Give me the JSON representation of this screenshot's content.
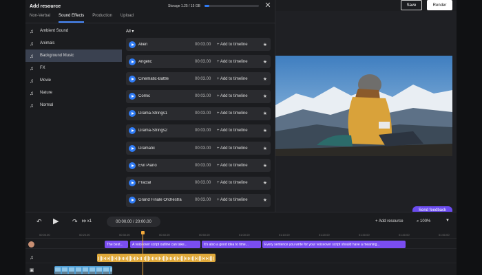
{
  "modal": {
    "title": "Add resource",
    "storage_label": "Storage 1.25 / 15 GB",
    "storage_fraction": 0.083,
    "tabs": [
      "Non-Verbal",
      "Sound Effects",
      "Production",
      "Upload"
    ],
    "active_tab": "Sound Effects",
    "categories": [
      "Ambient Sound",
      "Animals",
      "Background Music",
      "FX",
      "Movie",
      "Nature",
      "Normal"
    ],
    "active_category": "Background Music",
    "filter_label": "All",
    "add_label": "+ Add to timeline",
    "tracks": [
      {
        "name": "Alien",
        "duration": "00:03.00"
      },
      {
        "name": "Angelic",
        "duration": "00:03.00"
      },
      {
        "name": "Cinematic-Battle",
        "duration": "00:03.00"
      },
      {
        "name": "Comic",
        "duration": "00:03.00"
      },
      {
        "name": "Drama-Strings1",
        "duration": "00:03.00"
      },
      {
        "name": "Drama-Strings2",
        "duration": "00:03.00"
      },
      {
        "name": "Dramatic",
        "duration": "00:03.00"
      },
      {
        "name": "Evil Piano",
        "duration": "00:03.00"
      },
      {
        "name": "Fractal",
        "duration": "00:03.00"
      },
      {
        "name": "Grand Finale Orchestra",
        "duration": "00:03.00"
      }
    ]
  },
  "header": {
    "save_label": "Save",
    "render_label": "Render"
  },
  "preview": {
    "feedback_label": "Send feedback"
  },
  "timeline": {
    "speed_label": "x1",
    "time_display": "00:00.00 / 20:00.00",
    "add_resource_label": "Add resource",
    "zoom_label": "100%",
    "ticks": [
      "00:00.00",
      "00:20.00",
      "00:30.00",
      "00:40.00",
      "00:50.00",
      "01:00.00",
      "01:10.00",
      "01:20.00",
      "01:30.00",
      "01:40.00",
      "01:50.00"
    ],
    "voiceover_clips": [
      "The best...",
      "A voiceover script outline can take...",
      "It's also a good idea to time...",
      "Every sentence you write for your voiceover script should have a meaning..."
    ]
  },
  "colors": {
    "accent_blue": "#2f7bf5",
    "voiceover_purple": "#7a4df0",
    "audio_orange": "#e0a93a",
    "playhead": "#f2a93b"
  }
}
